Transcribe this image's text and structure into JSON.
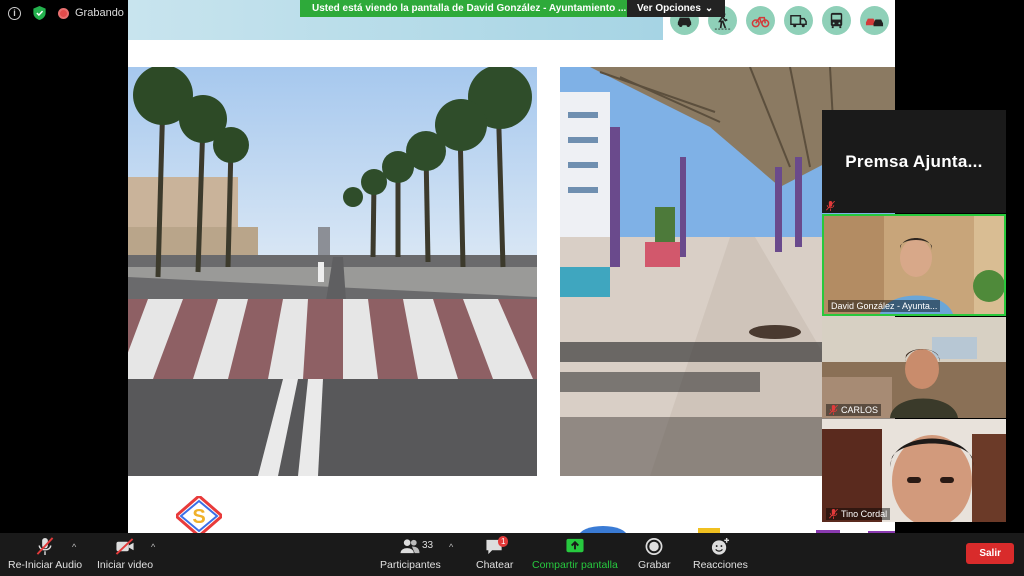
{
  "status": {
    "recording_label": "Grabando"
  },
  "share_banner": {
    "message": "Usted está viendo la pantalla de David González - Ayuntamiento ...",
    "options_label": "Ver Opciones"
  },
  "slide": {
    "transport_icons": [
      "car-icon",
      "pedestrian-icon",
      "bicycle-icon",
      "truck-icon",
      "bus-icon",
      "cars-icon"
    ],
    "colors": {
      "icon_bg": "#8fd0b8",
      "band": "#a6d4e4"
    }
  },
  "participants": [
    {
      "name": "Premsa  Ajunta...",
      "type": "label",
      "muted": true
    },
    {
      "name": "David González - Ayunta...",
      "active": true,
      "muted": false
    },
    {
      "name": "CARLOS",
      "muted": true
    },
    {
      "name": "Tino Cordal",
      "muted": true
    }
  ],
  "toolbar": {
    "audio_label": "Re-Iniciar Audio",
    "video_label": "Iniciar video",
    "participants_label": "Participantes",
    "participants_count": "33",
    "chat_label": "Chatear",
    "chat_badge": "1",
    "share_label": "Compartir pantalla",
    "record_label": "Grabar",
    "reactions_label": "Reacciones",
    "leave_label": "Salir",
    "colors": {
      "share": "#27c93f",
      "leave": "#d92b2b",
      "badge": "#e23a3a"
    }
  }
}
